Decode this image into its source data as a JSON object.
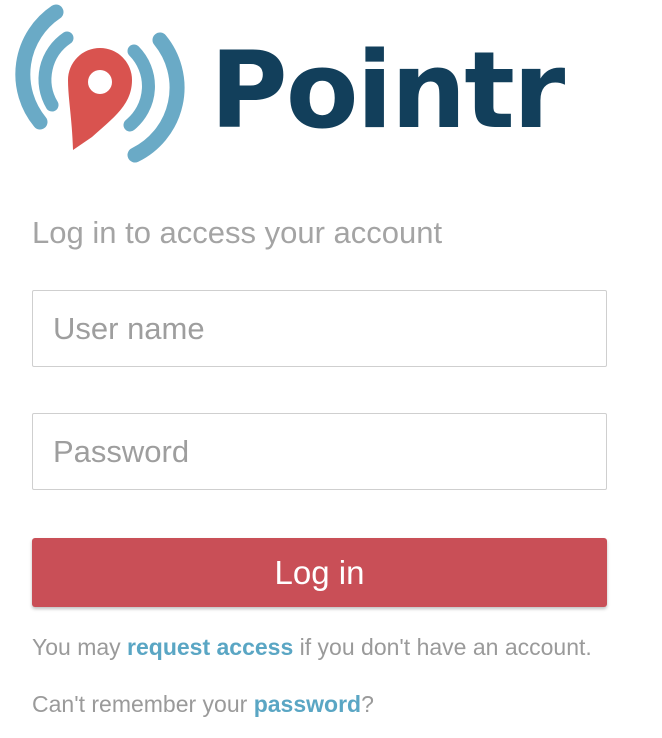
{
  "brand": {
    "name": "Pointr",
    "icon": "location-pin-with-signal-waves-icon"
  },
  "login": {
    "subtitle": "Log in to access your account",
    "username_placeholder": "User name",
    "password_placeholder": "Password",
    "button_label": "Log in"
  },
  "help": {
    "access_prefix": "You may ",
    "access_link": "request access",
    "access_suffix": " if you don't have an account.",
    "password_prefix": "Can't remember your ",
    "password_link": "password",
    "password_suffix": "?"
  },
  "colors": {
    "brand_dark": "#123f5b",
    "pin_red": "#d9534f",
    "wave_blue": "#6aaac6",
    "accent": "#c94f57",
    "link": "#5aa6c4"
  }
}
